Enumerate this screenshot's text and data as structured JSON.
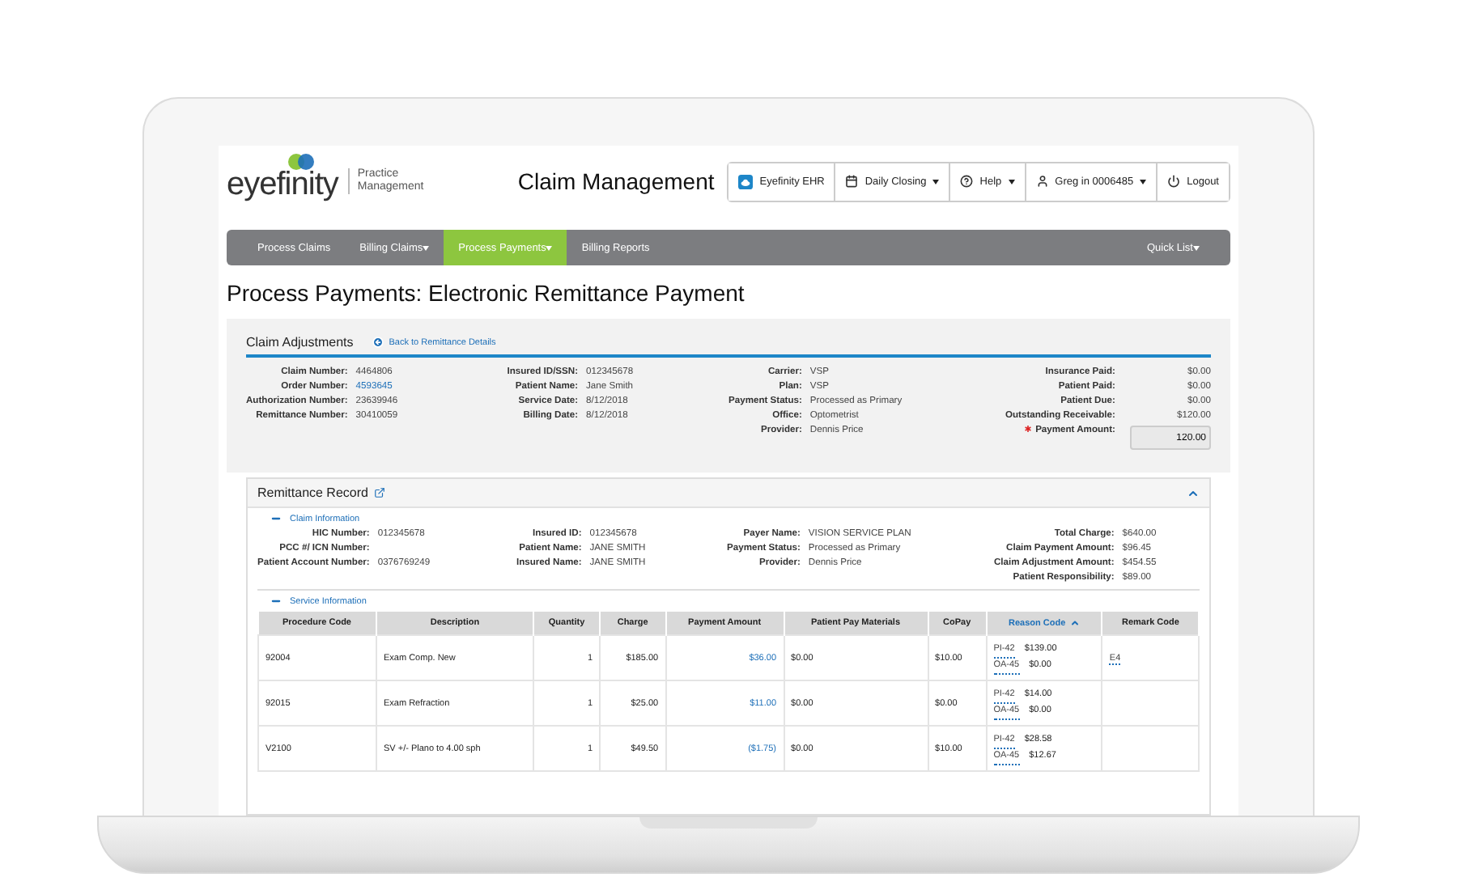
{
  "header": {
    "logo": {
      "brand": "eyefinity",
      "product": [
        "Practice",
        "Management"
      ]
    },
    "app_title": "Claim Management",
    "toolbar": [
      {
        "kind": "app",
        "label": "Eyefinity EHR",
        "dropdown": false
      },
      {
        "kind": "calendar",
        "label": "Daily Closing",
        "dropdown": true
      },
      {
        "kind": "help",
        "label": "Help",
        "dropdown": true
      },
      {
        "kind": "user",
        "label": "Greg in 0006485",
        "dropdown": true
      },
      {
        "kind": "power",
        "label": "Logout",
        "dropdown": false
      }
    ]
  },
  "nav": {
    "items": [
      {
        "label": "Process Claims",
        "dropdown": false,
        "selected": false
      },
      {
        "label": "Billing Claims",
        "dropdown": true,
        "selected": false
      },
      {
        "label": "Process Payments",
        "dropdown": true,
        "selected": true
      },
      {
        "label": "Billing Reports",
        "dropdown": false,
        "selected": false
      }
    ],
    "right": {
      "label": "Quick List",
      "dropdown": true
    }
  },
  "page_title": "Process Payments: Electronic Remittance Payment",
  "claim_adjustments": {
    "title": "Claim Adjustments",
    "back_link": "Back to Remittance Details",
    "groups": [
      [
        {
          "label": "Claim Number:",
          "value": "4464806",
          "kind": "text"
        },
        {
          "label": "Order Number:",
          "value": "4593645",
          "kind": "link"
        },
        {
          "label": "Authorization Number:",
          "value": "23639946",
          "kind": "text"
        },
        {
          "label": "Remittance Number:",
          "value": "30410059",
          "kind": "text"
        }
      ],
      [
        {
          "label": "Insured ID/SSN:",
          "value": "012345678",
          "kind": "text"
        },
        {
          "label": "Patient Name:",
          "value": "Jane Smith",
          "kind": "text"
        },
        {
          "label": "Service Date:",
          "value": "8/12/2018",
          "kind": "text"
        },
        {
          "label": "Billing Date:",
          "value": "8/12/2018",
          "kind": "text"
        }
      ],
      [
        {
          "label": "Carrier:",
          "value": "VSP",
          "kind": "text"
        },
        {
          "label": "Plan:",
          "value": "VSP",
          "kind": "text"
        },
        {
          "label": "Payment Status:",
          "value": "Processed as Primary",
          "kind": "text"
        },
        {
          "label": "Office:",
          "value": "Optometrist",
          "kind": "text"
        },
        {
          "label": "Provider:",
          "value": "Dennis Price",
          "kind": "text"
        }
      ],
      [
        {
          "label": "Insurance Paid:",
          "value": "$0.00",
          "kind": "text"
        },
        {
          "label": "Patient Paid:",
          "value": "$0.00",
          "kind": "text"
        },
        {
          "label": "Patient Due:",
          "value": "$0.00",
          "kind": "text"
        },
        {
          "label": "Outstanding Receivable:",
          "value": "$120.00",
          "kind": "text"
        },
        {
          "label": "Payment Amount:",
          "value": "120.00",
          "kind": "input",
          "required": true
        }
      ]
    ]
  },
  "remittance_record": {
    "title": "Remittance Record",
    "expanded": true,
    "claim_information": {
      "title": "Claim Information",
      "expanded": true,
      "groups": [
        [
          {
            "label": "HIC Number:",
            "value": "012345678"
          },
          {
            "label": "PCC #/ ICN Number:"
          },
          {
            "label": "Patient Account Number:",
            "value": "0376769249"
          }
        ],
        [
          {
            "label": "Insured ID:",
            "value": "012345678"
          },
          {
            "label": "Patient Name:",
            "value": "JANE SMITH"
          },
          {
            "label": "Insured Name:",
            "value": "JANE SMITH"
          }
        ],
        [
          {
            "label": "Payer Name:",
            "value": "VISION SERVICE PLAN"
          },
          {
            "label": "Payment Status:",
            "value": "Processed as Primary"
          },
          {
            "label": "Provider:",
            "value": "Dennis Price"
          }
        ],
        [
          {
            "label": "Total Charge:",
            "value": "$640.00"
          },
          {
            "label": "Claim Payment Amount:",
            "value": "$96.45"
          },
          {
            "label": "Claim Adjustment Amount:",
            "value": "$454.55"
          },
          {
            "label": "Patient Responsibility:",
            "value": "$89.00"
          }
        ]
      ]
    },
    "service_information": {
      "title": "Service Information",
      "expanded": true,
      "columns": [
        {
          "label": "Procedure Code",
          "sorted": false
        },
        {
          "label": "Description",
          "sorted": false
        },
        {
          "label": "Quantity",
          "sorted": false
        },
        {
          "label": "Charge",
          "sorted": false
        },
        {
          "label": "Payment Amount",
          "sorted": false
        },
        {
          "label": "Patient Pay Materials",
          "sorted": false
        },
        {
          "label": "CoPay",
          "sorted": false
        },
        {
          "label": "Reason Code",
          "sorted": true
        },
        {
          "label": "Remark Code",
          "sorted": false
        }
      ],
      "rows": [
        {
          "procedure_code": "92004",
          "description": "Exam Comp. New",
          "quantity": "1",
          "charge": "$185.00",
          "payment_amount": "$36.00",
          "patient_pay_materials": "$0.00",
          "copay": "$10.00",
          "reason_codes": [
            {
              "code": "PI-42",
              "amount": "$139.00"
            },
            {
              "code": "OA-45",
              "amount": "$0.00"
            }
          ],
          "remark_code": "E4"
        },
        {
          "procedure_code": "92015",
          "description": "Exam Refraction",
          "quantity": "1",
          "charge": "$25.00",
          "payment_amount": "$11.00",
          "patient_pay_materials": "$0.00",
          "copay": "$0.00",
          "reason_codes": [
            {
              "code": "PI-42",
              "amount": "$14.00"
            },
            {
              "code": "OA-45",
              "amount": "$0.00"
            }
          ]
        },
        {
          "procedure_code": "V2100",
          "description": "SV +/- Plano to 4.00 sph",
          "quantity": "1",
          "charge": "$49.50",
          "payment_amount": "($1.75)",
          "patient_pay_materials": "$0.00",
          "copay": "$10.00",
          "reason_codes": [
            {
              "code": "PI-42",
              "amount": "$28.58"
            },
            {
              "code": "OA-45",
              "amount": "$12.67"
            }
          ]
        }
      ]
    }
  }
}
